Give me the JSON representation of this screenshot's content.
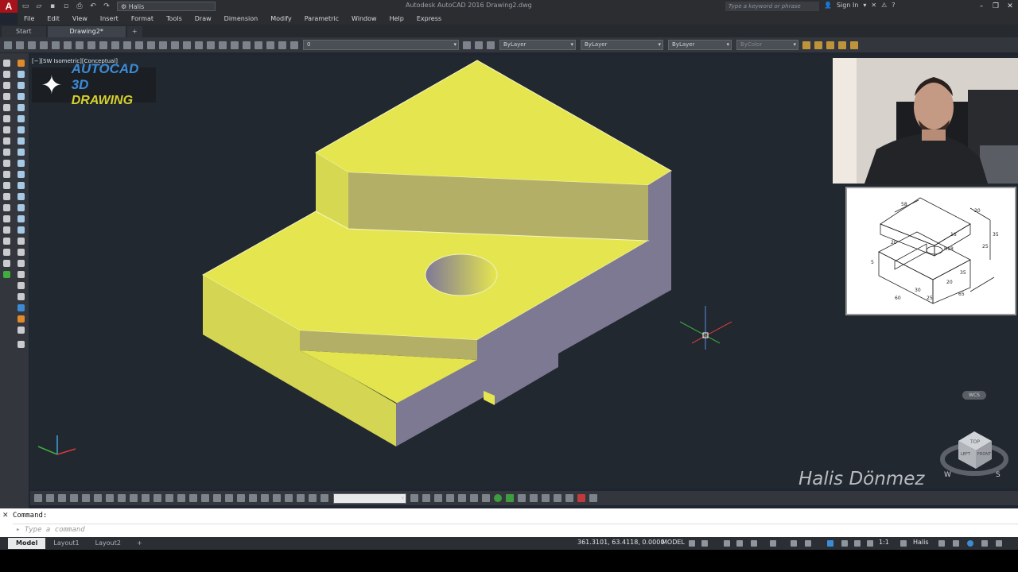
{
  "app": {
    "logo_letter": "A",
    "workspace": "Halis",
    "title": "Autodesk AutoCAD 2016   Drawing2.dwg",
    "search_placeholder": "Type a keyword or phrase",
    "sign_in": "Sign In",
    "window_buttons": [
      "–",
      "❐",
      "✕"
    ]
  },
  "menus": [
    "File",
    "Edit",
    "View",
    "Insert",
    "Format",
    "Tools",
    "Draw",
    "Dimension",
    "Modify",
    "Parametric",
    "Window",
    "Help",
    "Express"
  ],
  "file_tabs": [
    {
      "label": "Start",
      "active": false
    },
    {
      "label": "Drawing2*",
      "active": true
    },
    {
      "label": "+",
      "active": false
    }
  ],
  "ribbon": {
    "layer_value": "0",
    "color_value": "ByLayer",
    "linetype_value": "ByLayer",
    "lineweight_value": "ByLayer",
    "plotstyle_value": "ByColor"
  },
  "viewport": {
    "label": "[−][SW Isometric][Conceptual]",
    "brand_line1": "AUTOCAD 3D",
    "brand_line2": "DRAWING",
    "author": "Halis Dönmez",
    "wcs": "WCS",
    "viewcube_face": "TOP",
    "viewcube_left": "LEFT",
    "viewcube_front": "FRONT",
    "compass": [
      "W",
      "S"
    ]
  },
  "reference": {
    "dimensions": [
      "58",
      "16",
      "R18",
      "20",
      "35",
      "25",
      "30",
      "20",
      "35",
      "65",
      "60",
      "25",
      "5",
      "20"
    ]
  },
  "command": {
    "history": "Command:",
    "placeholder": "Type a command",
    "close": "✕"
  },
  "status": {
    "layout_tabs": [
      {
        "label": "Model",
        "active": true
      },
      {
        "label": "Layout1",
        "active": false
      },
      {
        "label": "Layout2",
        "active": false
      },
      {
        "label": "+",
        "active": false
      }
    ],
    "coordinates": "361.3101, 63.4118, 0.0000",
    "model": "MODEL",
    "scale": "1:1",
    "user": "Halis"
  },
  "colors": {
    "face_top": "#e5e64f",
    "face_front": "#cfd052",
    "face_side": "#7e7992",
    "background": "#212830",
    "accent_red": "#a8131b"
  }
}
